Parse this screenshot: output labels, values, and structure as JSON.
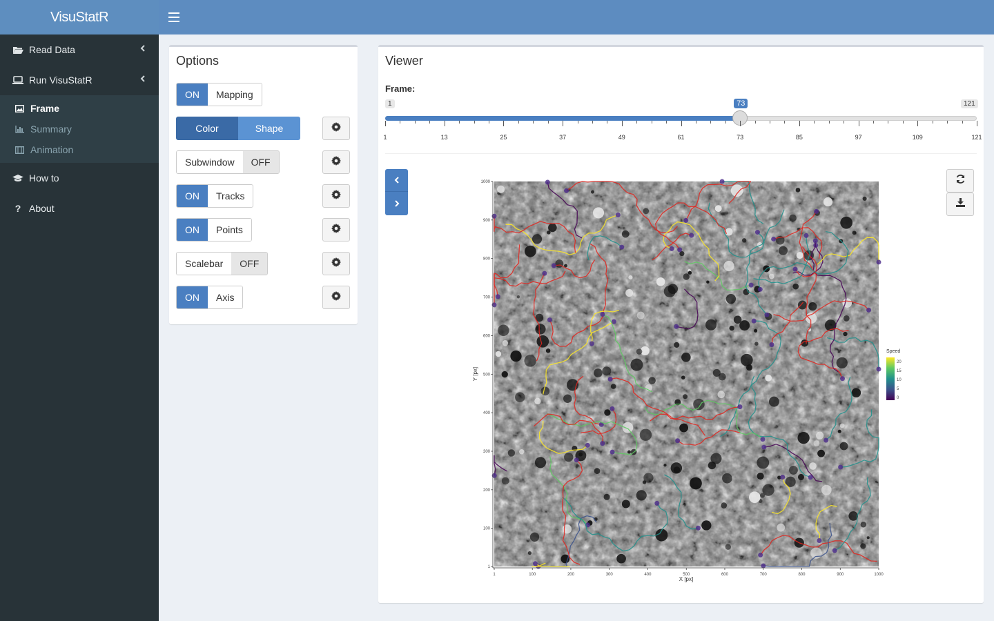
{
  "app": {
    "title": "VisuStatR"
  },
  "sidebar": {
    "items": [
      {
        "label": "Read Data",
        "icon": "folder-open-icon"
      },
      {
        "label": "Run VisuStatR",
        "icon": "laptop-icon"
      },
      {
        "label": "How to",
        "icon": "graduation-cap-icon"
      },
      {
        "label": "About",
        "icon": "question-icon"
      }
    ],
    "submenu": [
      {
        "label": "Frame",
        "icon": "image-icon",
        "active": true
      },
      {
        "label": "Summary",
        "icon": "bar-chart-icon"
      },
      {
        "label": "Animation",
        "icon": "film-icon"
      }
    ]
  },
  "options": {
    "title": "Options",
    "mapping": {
      "state": "ON",
      "label": "Mapping"
    },
    "mode": {
      "color": "Color",
      "shape": "Shape"
    },
    "subwindow": {
      "label": "Subwindow",
      "state": "OFF"
    },
    "tracks": {
      "state": "ON",
      "label": "Tracks"
    },
    "points": {
      "state": "ON",
      "label": "Points"
    },
    "scalebar": {
      "label": "Scalebar",
      "state": "OFF"
    },
    "axis": {
      "state": "ON",
      "label": "Axis"
    }
  },
  "viewer": {
    "title": "Viewer",
    "frame_label": "Frame:",
    "slider": {
      "min": 1,
      "max": 121,
      "value": 73,
      "ticks": [
        1,
        13,
        25,
        37,
        49,
        61,
        73,
        85,
        97,
        109,
        121
      ]
    },
    "slider_text": {
      "min": "1",
      "max": "121",
      "value": "73"
    }
  },
  "chart_data": {
    "type": "scatter",
    "xlabel": "X [px]",
    "ylabel": "Y [px]",
    "xlim": [
      1,
      1000
    ],
    "ylim": [
      1,
      1000
    ],
    "x_ticks": [
      "1",
      "100",
      "200",
      "300",
      "400",
      "500",
      "600",
      "700",
      "800",
      "900",
      "1000"
    ],
    "y_ticks": [
      "1",
      "100",
      "200",
      "300",
      "400",
      "500",
      "600",
      "700",
      "800",
      "900",
      "1000"
    ],
    "legend": {
      "title": "Speed",
      "ticks": [
        "20",
        "15",
        "10",
        "5",
        "0"
      ],
      "placement": "right"
    },
    "colors": {
      "scale": [
        "#fde725",
        "#5ec962",
        "#21918c",
        "#3b528b",
        "#440154"
      ],
      "tracks_red": "#e0261f"
    }
  },
  "colors": {
    "accent": "#4a7fc1",
    "header": "#5d8cc0",
    "sidebar": "#283338"
  }
}
